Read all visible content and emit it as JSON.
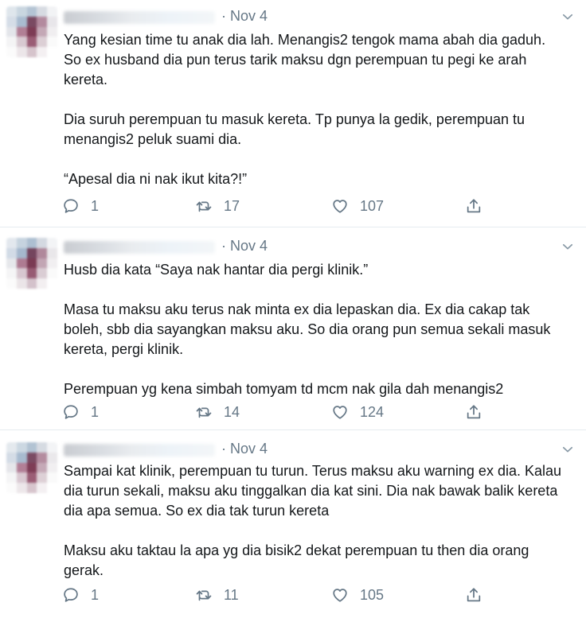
{
  "tweets": [
    {
      "date": "Nov 4",
      "paragraphs": [
        "Yang kesian time tu anak dia lah. Menangis2 tengok mama abah dia gaduh.\nSo ex husband dia pun terus tarik maksu dgn perempuan tu pegi ke arah\nkereta.",
        "Dia suruh perempuan tu masuk kereta. Tp punya la gedik, perempuan tu\nmenangis2 peluk suami dia.",
        "“Apesal dia ni nak ikut kita?!”"
      ],
      "replies": "1",
      "retweets": "17",
      "likes": "107"
    },
    {
      "date": "Nov 4",
      "paragraphs": [
        "Husb dia kata “Saya nak hantar dia pergi klinik.”",
        "Masa tu maksu aku terus nak minta ex dia lepaskan dia. Ex dia cakap tak\nboleh, sbb dia sayangkan maksu aku. So dia orang pun semua sekali masuk\nkereta, pergi klinik.",
        "Perempuan yg kena simbah tomyam td mcm nak gila dah menangis2"
      ],
      "replies": "1",
      "retweets": "14",
      "likes": "124"
    },
    {
      "date": "Nov 4",
      "paragraphs": [
        "Sampai kat klinik, perempuan tu turun. Terus maksu aku warning ex dia. Kalau\ndia turun sekali, maksu aku tinggalkan dia kat sini. Dia nak bawak balik kereta\ndia apa semua. So ex dia tak turun kereta",
        "Maksu aku taktau la apa yg dia bisik2 dekat perempuan tu then dia orang\ngerak."
      ],
      "replies": "1",
      "retweets": "11",
      "likes": "105"
    }
  ],
  "icons": {
    "reply": "reply-icon",
    "retweet": "retweet-icon",
    "like": "heart-icon",
    "share": "share-icon",
    "menu": "chevron-down-icon"
  },
  "colors": {
    "text": "#14171a",
    "muted": "#657786",
    "divider": "#e6ecf0"
  }
}
